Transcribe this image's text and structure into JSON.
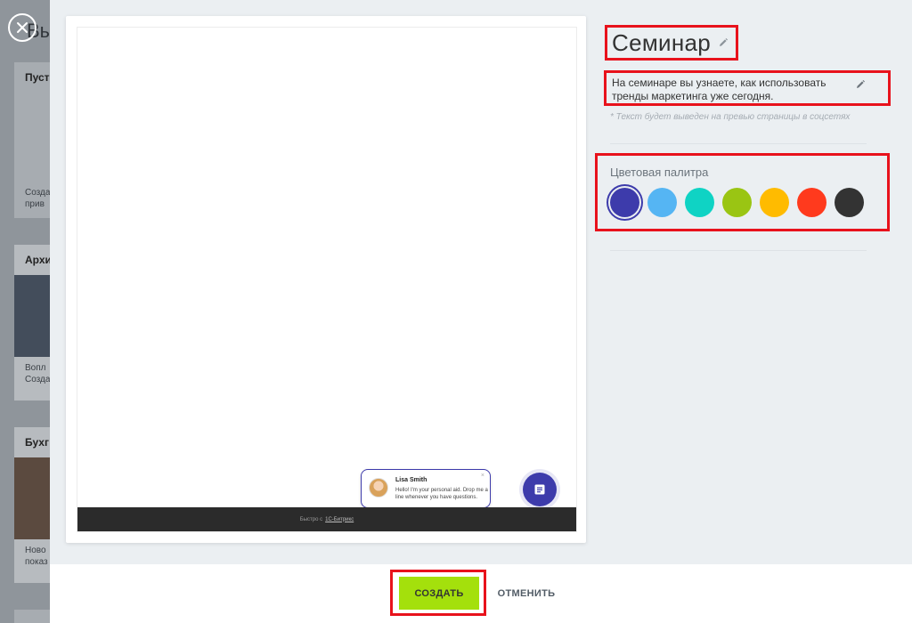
{
  "background": {
    "title": "Вы",
    "cards": [
      {
        "title": "Пуст",
        "text1": "Созда",
        "text2": "прив"
      },
      {
        "title": "Архи",
        "text1": "Вопл",
        "text2": "Созда"
      },
      {
        "title": "Бухг",
        "text1": "Ново",
        "text2": "показ"
      }
    ]
  },
  "preview": {
    "chat": {
      "name": "Lisa Smith",
      "message": "Hello! I'm your personal aid. Drop me a line whenever you have questions.",
      "close": "×"
    },
    "footer": {
      "prefix": "Быстро с",
      "brand": "1С-Битрикс"
    }
  },
  "settings": {
    "title": "Семинар",
    "description": "На семинаре вы узнаете, как использовать тренды маркетинга уже сегодня.",
    "hint": "* Текст будет выведен на превью страницы в соцсетях",
    "palette_label": "Цветовая палитра",
    "colors": [
      "#3d3bab",
      "#55b5f3",
      "#0fd3c4",
      "#9ac513",
      "#ffbb00",
      "#ff3a1d",
      "#333333"
    ],
    "selected_color": "#3d3bab"
  },
  "actions": {
    "create": "СОЗДАТЬ",
    "cancel": "ОТМЕНИТЬ"
  },
  "icons": {
    "close": "close-icon",
    "edit": "pencil-icon",
    "chat": "chat-icon"
  }
}
